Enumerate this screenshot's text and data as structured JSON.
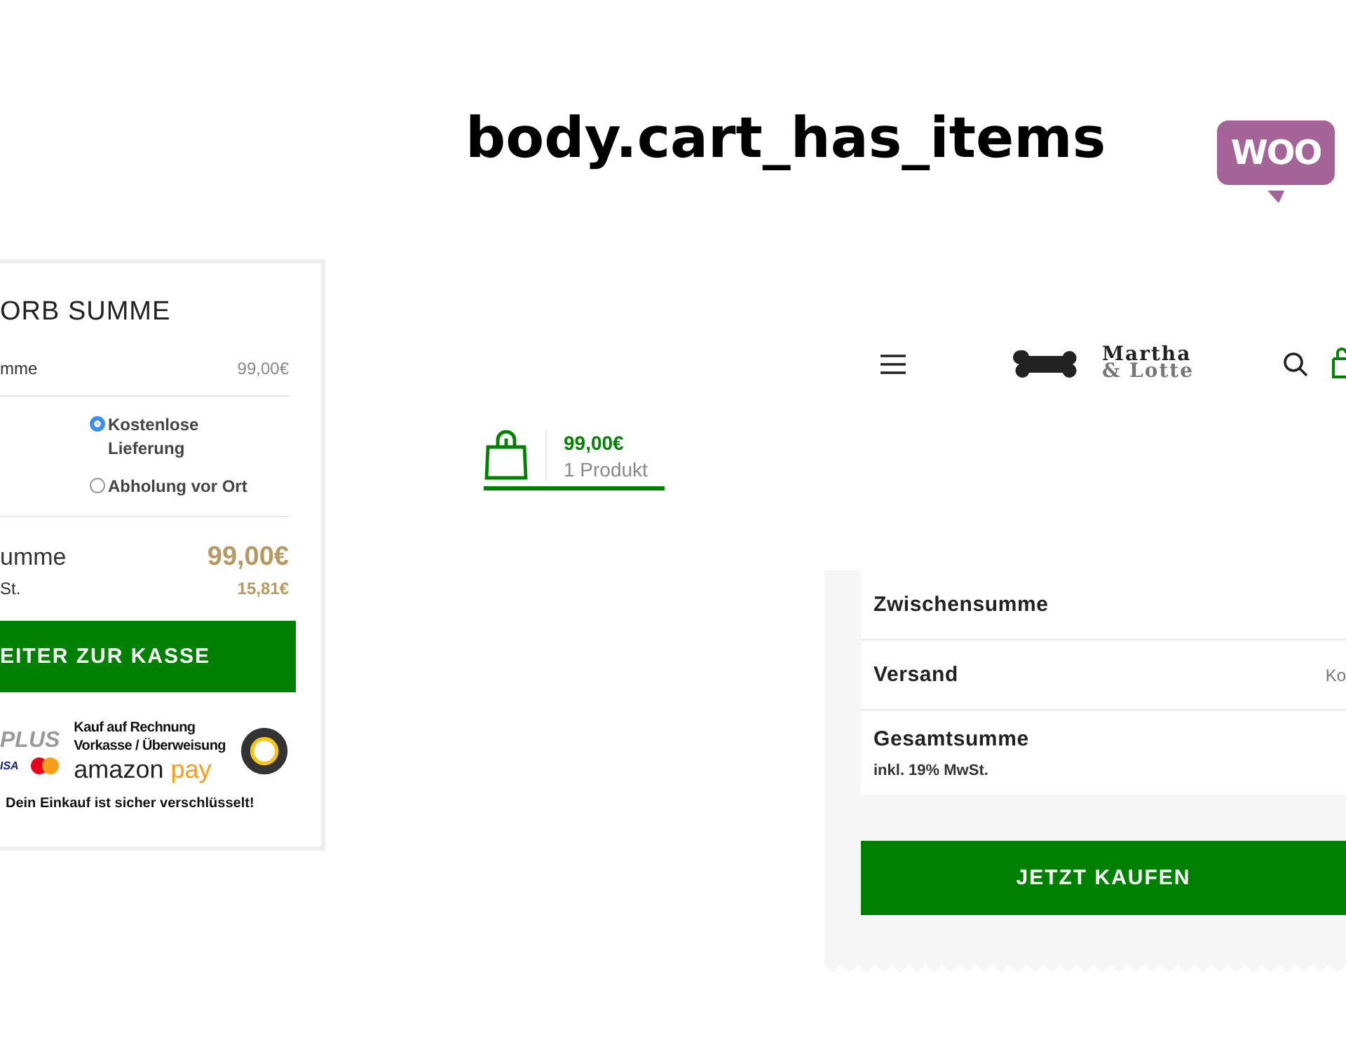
{
  "heading": "body.cart_has_items",
  "woo_logo": "WOO",
  "cart_total_card": {
    "title": "ORB SUMME",
    "subtotal_label": "mme",
    "subtotal_value": "99,00€",
    "shipping_options": [
      {
        "label": "Kostenlose Lieferung",
        "selected": true
      },
      {
        "label": "Abholung vor Ort",
        "selected": false
      }
    ],
    "total_label": "umme",
    "total_value": "99,00€",
    "tax_label": "St.",
    "tax_value": "15,81€",
    "checkout_button": "EITER ZUR KASSE",
    "payment": {
      "plus": "PLUS",
      "visa": "ISA",
      "lines": [
        "Kauf auf Rechnung",
        "Vorkasse / Überweisung"
      ],
      "amazon": "amazon",
      "pay": "pay"
    },
    "secure_note": "Dein Einkauf ist sicher verschlüsselt!"
  },
  "header": {
    "logo_line1": "Martha",
    "logo_line2": "& Lotte"
  },
  "mini_cart": {
    "price": "99,00€",
    "count": "1 Produkt"
  },
  "checkout_panel": {
    "rows": [
      {
        "label": "Zwischensumme"
      },
      {
        "label": "Versand",
        "value": "Ko"
      },
      {
        "label": "Gesamtsumme",
        "note": "inkl. 19% MwSt."
      }
    ],
    "buy_button": "JETZT KAUFEN"
  }
}
